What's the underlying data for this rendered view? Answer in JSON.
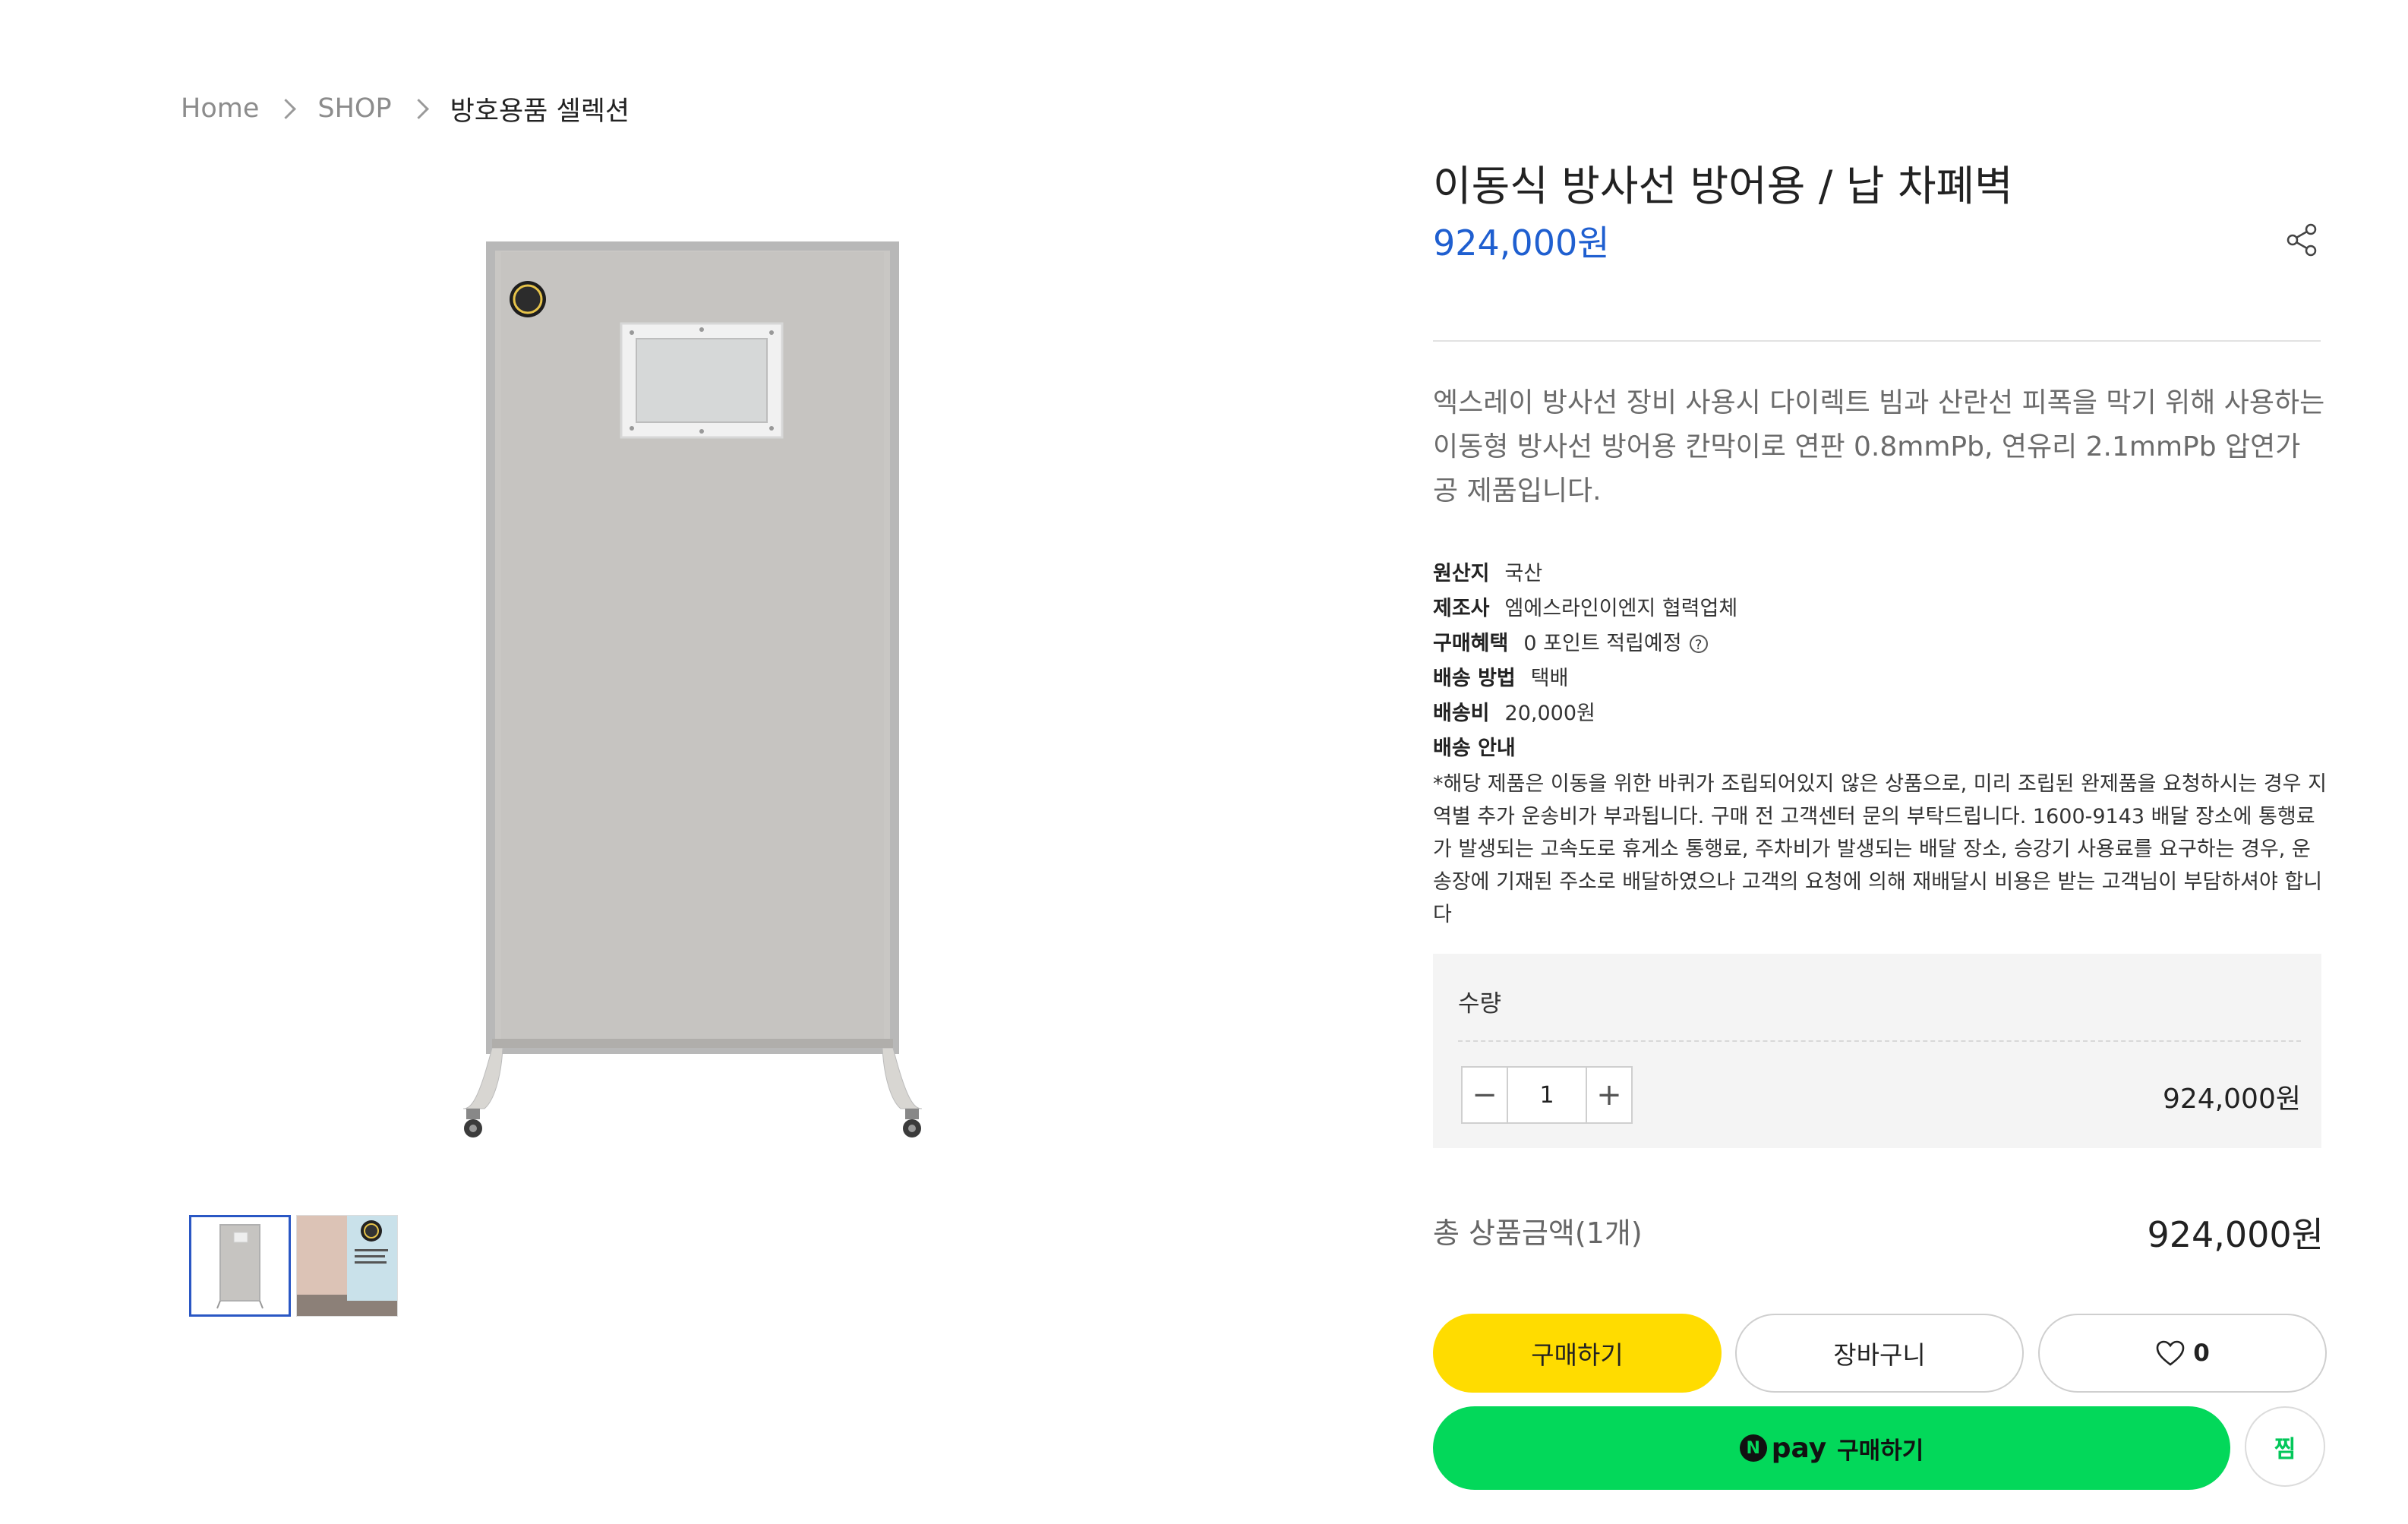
{
  "breadcrumb": {
    "items": [
      "Home",
      "SHOP",
      "방호용품 셀렉션"
    ]
  },
  "product": {
    "title": "이동식 방사선 방어용 / 납 차폐벽",
    "price": "924,000원",
    "description": "엑스레이 방사선 장비 사용시 다이렉트 빔과 산란선 피폭을 막기 위해 사용하는 이동형 방사선 방어용 칸막이로 연판 0.8mmPb, 연유리 2.1mmPb 압연가공 제품입니다.",
    "info": {
      "origin_label": "원산지",
      "origin_value": "국산",
      "maker_label": "제조사",
      "maker_value": "엠에스라인이엔지 협력업체",
      "benefit_label": "구매혜택",
      "benefit_value": "0 포인트 적립예정",
      "ship_method_label": "배송 방법",
      "ship_method_value": "택배",
      "ship_fee_label": "배송비",
      "ship_fee_value": "20,000원",
      "ship_guide_label": "배송 안내",
      "ship_guide_text": "*해당 제품은 이동을 위한 바퀴가 조립되어있지 않은 상품으로, 미리 조립된 완제품을 요청하시는 경우 지역별 추가 운송비가 부과됩니다. 구매 전 고객센터 문의 부탁드립니다. 1600-9143 배달 장소에 통행료가 발생되는 고속도로 휴게소 통행료, 주차비가 발생되는 배달 장소, 승강기 사용료를 요구하는 경우, 운송장에 기재된 주소로 배달하였으나 고객의 요청에 의해 재배달시 비용은 받는 고객님이 부담하셔야 합니다"
    }
  },
  "option": {
    "quantity_label": "수량",
    "quantity": "1",
    "minus": "−",
    "plus": "+",
    "line_price": "924,000원"
  },
  "total": {
    "label": "총 상품금액(1개)",
    "price": "924,000원"
  },
  "actions": {
    "buy": "구매하기",
    "cart": "장바구니",
    "like_count": "0",
    "npay_pay": "pay",
    "npay_buy": "구매하기",
    "zzim": "찜"
  },
  "icons": {
    "share": "share-icon",
    "heart": "heart-icon",
    "help": "help-circle-icon",
    "chevron": "chevron-right-icon"
  },
  "colors": {
    "price_blue": "#1f5fd0",
    "buy_yellow": "#ffdc00",
    "npay_green": "#03d85a",
    "thumb_selected": "#2a57c4"
  }
}
